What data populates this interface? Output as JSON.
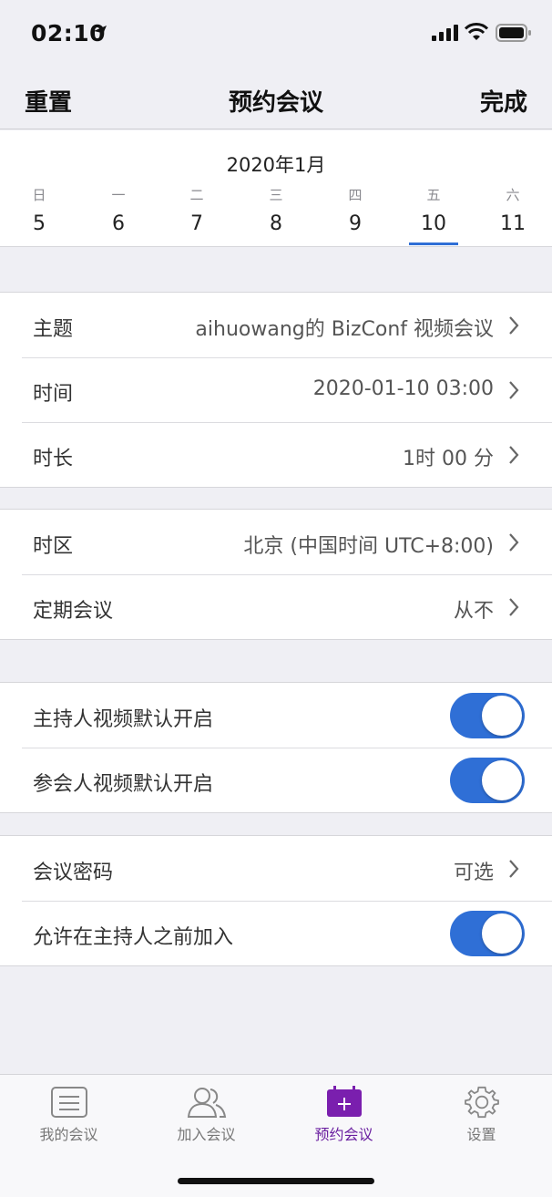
{
  "status_bar": {
    "time": "02:10"
  },
  "nav": {
    "left": "重置",
    "title": "预约会议",
    "right": "完成"
  },
  "calendar": {
    "month": "2020年1月",
    "weekdays": [
      "日",
      "一",
      "二",
      "三",
      "四",
      "五",
      "六"
    ],
    "days": [
      "5",
      "6",
      "7",
      "8",
      "9",
      "10",
      "11"
    ],
    "selected_index": 5
  },
  "group1": {
    "topic": {
      "label": "主题",
      "value": "aihuowang的 BizConf 视频会议"
    },
    "time": {
      "label": "时间",
      "value": "2020-01-10 03:00"
    },
    "duration": {
      "label": "时长",
      "value": "1时 00 分"
    }
  },
  "group2": {
    "timezone": {
      "label": "时区",
      "value": "北京 (中国时间 UTC+8:00)"
    },
    "recurring": {
      "label": "定期会议",
      "value": "从不"
    }
  },
  "group3": {
    "host_video": {
      "label": "主持人视频默认开启",
      "on": true
    },
    "participant_video": {
      "label": "参会人视频默认开启",
      "on": true
    }
  },
  "group4": {
    "password": {
      "label": "会议密码",
      "value": "可选"
    },
    "join_before_host": {
      "label": "允许在主持人之前加入",
      "on": true
    }
  },
  "tabs": [
    {
      "label": "我的会议",
      "icon": "meetings-list-icon"
    },
    {
      "label": "加入会议",
      "icon": "join-people-icon"
    },
    {
      "label": "预约会议",
      "icon": "schedule-calendar-icon",
      "active": true
    },
    {
      "label": "设置",
      "icon": "settings-gear-icon"
    }
  ],
  "colors": {
    "accent_blue": "#2f6fd6",
    "active_purple": "#6a1fa0",
    "background": "#efeff4"
  }
}
